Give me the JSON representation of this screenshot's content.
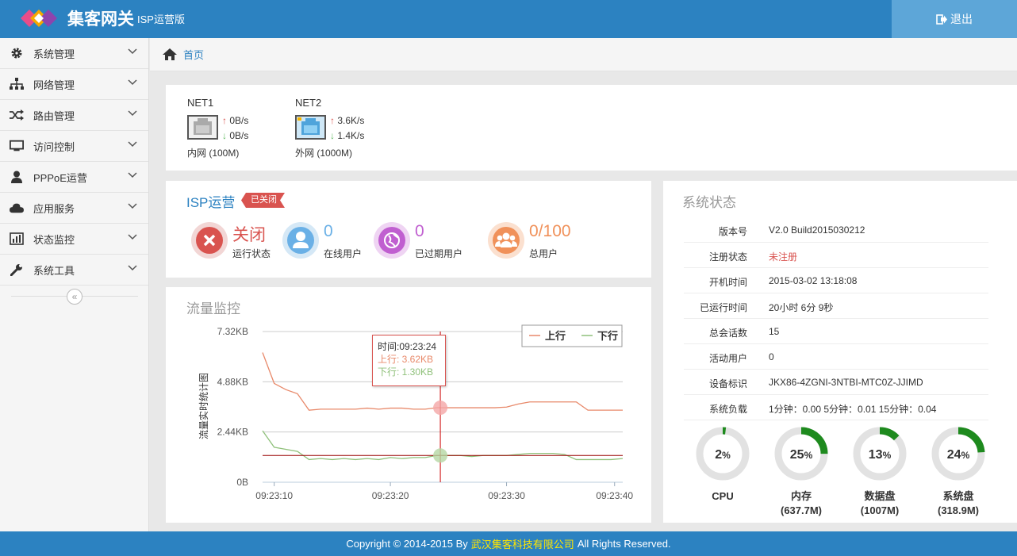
{
  "header": {
    "brand": "集客网关",
    "brand_sub": "ISP运营版",
    "logout": "退出"
  },
  "sidebar": {
    "items": [
      {
        "label": "系统管理",
        "icon": "gear-icon"
      },
      {
        "label": "网络管理",
        "icon": "sitemap-icon"
      },
      {
        "label": "路由管理",
        "icon": "shuffle-icon"
      },
      {
        "label": "访问控制",
        "icon": "monitor-icon"
      },
      {
        "label": "PPPoE运营",
        "icon": "user-icon"
      },
      {
        "label": "应用服务",
        "icon": "cloud-icon"
      },
      {
        "label": "状态监控",
        "icon": "bar-chart-icon"
      },
      {
        "label": "系统工具",
        "icon": "wrench-icon"
      }
    ]
  },
  "breadcrumb": {
    "home": "首页"
  },
  "net": [
    {
      "name": "NET1",
      "up": "0B/s",
      "down": "0B/s",
      "desc": "内网 (100M)",
      "color": "#f0f0f0"
    },
    {
      "name": "NET2",
      "up": "3.6K/s",
      "down": "1.4K/s",
      "desc": "外网 (1000M)",
      "color": "#7cc3ef"
    }
  ],
  "isp": {
    "title": "ISP运营",
    "badge": "已关闭",
    "stats": [
      {
        "value": "关闭",
        "label": "运行状态",
        "color": "#d9534f",
        "icon": "close-icon"
      },
      {
        "value": "0",
        "label": "在线用户",
        "color": "#6ab0e6",
        "icon": "user-icon"
      },
      {
        "value": "0",
        "label": "已过期用户",
        "color": "#c05fd0",
        "icon": "globe-icon"
      },
      {
        "value": "0/100",
        "label": "总用户",
        "color": "#f0915a",
        "icon": "users-icon"
      }
    ]
  },
  "traffic": {
    "title": "流量监控",
    "tooltip": {
      "time": "时间:09:23:24",
      "up": "上行: 3.62KB",
      "down": "下行: 1.30KB"
    }
  },
  "chart_data": {
    "type": "line",
    "ylabel": "流量实时统计图",
    "yticks": [
      "7.32KB",
      "4.88KB",
      "2.44KB",
      "0B"
    ],
    "ylim": [
      0,
      7.32
    ],
    "xticks": [
      "09:23:10",
      "09:23:20",
      "09:23:30",
      "09:23:40"
    ],
    "x": [
      9,
      10,
      11,
      12,
      13,
      14,
      15,
      16,
      17,
      18,
      19,
      20,
      21,
      22,
      23,
      24,
      25,
      26,
      27,
      28,
      29,
      30,
      31,
      32,
      33,
      34,
      35,
      36,
      37,
      38,
      39,
      40
    ],
    "series": [
      {
        "name": "上行",
        "color": "#e8896a",
        "values": [
          6.3,
          4.8,
          4.5,
          4.3,
          3.5,
          3.55,
          3.55,
          3.55,
          3.55,
          3.6,
          3.55,
          3.6,
          3.6,
          3.55,
          3.55,
          3.62,
          3.62,
          3.62,
          3.62,
          3.62,
          3.62,
          3.65,
          3.8,
          3.9,
          3.9,
          3.9,
          3.9,
          3.9,
          3.5,
          3.5,
          3.5,
          3.5
        ]
      },
      {
        "name": "下行",
        "color": "#8fc07a",
        "values": [
          2.5,
          1.7,
          1.6,
          1.5,
          1.1,
          1.15,
          1.1,
          1.15,
          1.1,
          1.15,
          1.1,
          1.2,
          1.15,
          1.2,
          1.2,
          1.3,
          1.3,
          1.3,
          1.25,
          1.3,
          1.3,
          1.3,
          1.35,
          1.4,
          1.4,
          1.4,
          1.35,
          1.1,
          1.1,
          1.1,
          1.1,
          1.15
        ]
      }
    ],
    "legend": "top-right",
    "grid": true
  },
  "sys": {
    "title": "系统状态",
    "rows": [
      {
        "k": "版本号",
        "v": "V2.0 Build2015030212",
        "color": "#333"
      },
      {
        "k": "注册状态",
        "v": "未注册",
        "color": "#d9534f"
      },
      {
        "k": "开机时间",
        "v": "2015-03-02 13:18:08",
        "color": "#333"
      },
      {
        "k": "已运行时间",
        "v": "20小时 6分 9秒",
        "color": "#333"
      },
      {
        "k": "总会话数",
        "v": "15",
        "color": "#333"
      },
      {
        "k": "活动用户",
        "v": "0",
        "color": "#333"
      },
      {
        "k": "设备标识",
        "v": "JKX86-4ZGNI-3NTBI-MTC0Z-JJIMD",
        "color": "#333"
      },
      {
        "k": "系统负载",
        "v": "1分钟：0.00   5分钟：0.01   15分钟：0.04",
        "color": "#333"
      }
    ],
    "gauges": [
      {
        "pct": 2,
        "label": "CPU",
        "sub": ""
      },
      {
        "pct": 25,
        "label": "内存",
        "sub": "(637.7M)"
      },
      {
        "pct": 13,
        "label": "数据盘",
        "sub": "(1007M)"
      },
      {
        "pct": 24,
        "label": "系统盘",
        "sub": "(318.9M)"
      }
    ]
  },
  "footer": {
    "pre": "Copyright © 2014-2015 By",
    "company": "武汉集客科技有限公司",
    "post": "All Rights Reserved."
  }
}
